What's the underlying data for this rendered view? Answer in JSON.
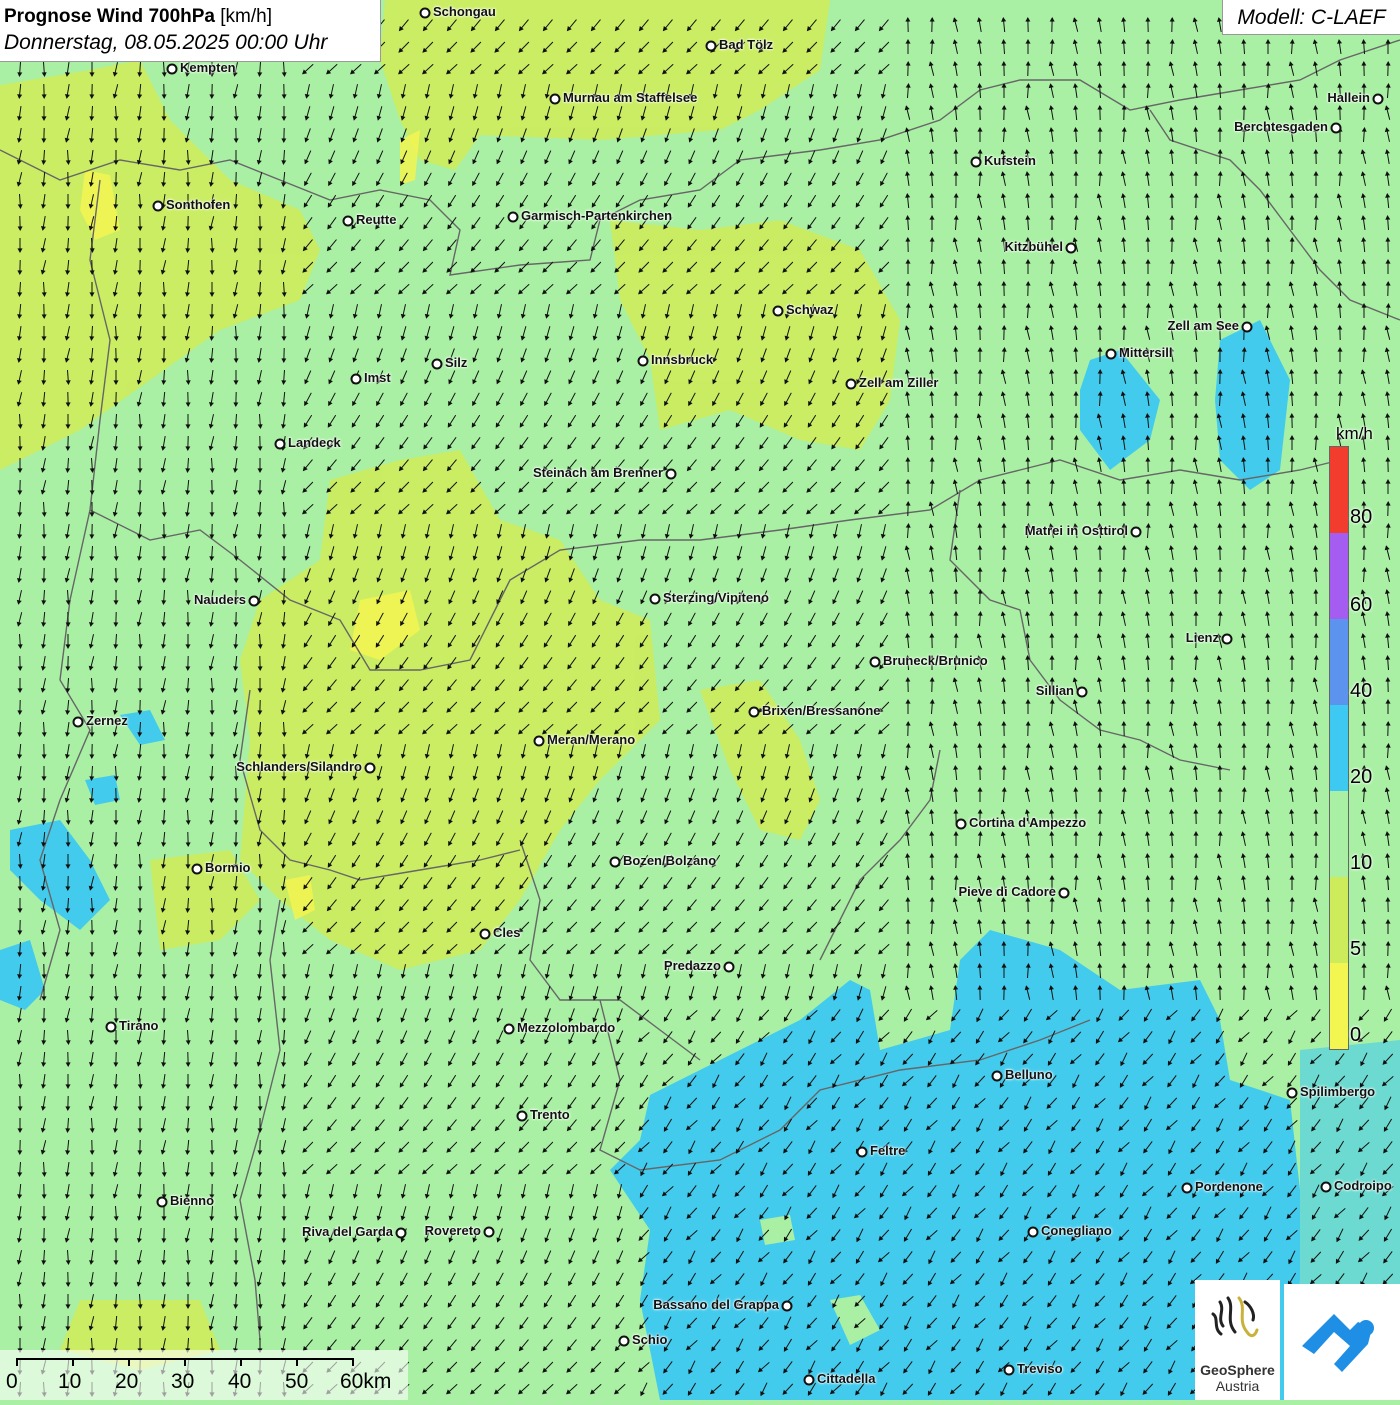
{
  "title": {
    "bold": "Prognose Wind 700hPa",
    "unit": "[km/h]",
    "date": "Donnerstag, 08.05.2025 00:00 Uhr"
  },
  "model": "Modell: C-LAEF",
  "legend": {
    "unit": "km/h",
    "ticks": [
      "80",
      "60",
      "40",
      "20",
      "10",
      "5",
      "0"
    ],
    "colors": [
      "#f23c2e",
      "#a55cf0",
      "#5c93ee",
      "#3ec9f2",
      "#a9f0a4",
      "#cdec5c",
      "#f3f550"
    ]
  },
  "scale": {
    "labels": [
      "0",
      "10",
      "20",
      "30",
      "40",
      "50",
      "60km"
    ]
  },
  "logo": {
    "name": "GeoSphere",
    "sub": "Austria"
  },
  "colors": {
    "calm_green": "#a9f0a4",
    "yellow_green": "#cdec5c",
    "blue": "#3ec9f2",
    "border": "#666666"
  },
  "cities": [
    {
      "name": "Schongau"
    },
    {
      "name": "Kempten"
    },
    {
      "name": "Bad Tölz"
    },
    {
      "name": "Murnau am Staffelsee"
    },
    {
      "name": "Hallein"
    },
    {
      "name": "Berchtesgaden"
    },
    {
      "name": "Kufstein"
    },
    {
      "name": "Sonthofen"
    },
    {
      "name": "Reutte"
    },
    {
      "name": "Garmisch-Partenkirchen"
    },
    {
      "name": "Kitzbühel"
    },
    {
      "name": "Schwaz"
    },
    {
      "name": "Zell am See"
    },
    {
      "name": "Mittersill"
    },
    {
      "name": "Innsbruck"
    },
    {
      "name": "Silz"
    },
    {
      "name": "Imst"
    },
    {
      "name": "Zell am Ziller"
    },
    {
      "name": "Landeck"
    },
    {
      "name": "Steinach am Brenner"
    },
    {
      "name": "Matrei in Osttirol"
    },
    {
      "name": "Nauders"
    },
    {
      "name": "Sterzing/Vipiteno"
    },
    {
      "name": "Lienz"
    },
    {
      "name": "Bruneck/Brunico"
    },
    {
      "name": "Sillian"
    },
    {
      "name": "Zernez"
    },
    {
      "name": "Brixen/Bressanone"
    },
    {
      "name": "Meran/Merano"
    },
    {
      "name": "Schlanders/Silandro"
    },
    {
      "name": "Cortina d'Ampezzo"
    },
    {
      "name": "Bormio"
    },
    {
      "name": "Bozen/Bolzano"
    },
    {
      "name": "Pieve di Cadore"
    },
    {
      "name": "Cles"
    },
    {
      "name": "Predazzo"
    },
    {
      "name": "Tirano"
    },
    {
      "name": "Mezzolombardo"
    },
    {
      "name": "Belluno"
    },
    {
      "name": "Spilimbergo"
    },
    {
      "name": "Trento"
    },
    {
      "name": "Feltre"
    },
    {
      "name": "Pordenone"
    },
    {
      "name": "Codroipo"
    },
    {
      "name": "Bienno"
    },
    {
      "name": "Riva del Garda"
    },
    {
      "name": "Rovereto"
    },
    {
      "name": "Conegliano"
    },
    {
      "name": "Bassano del Grappa"
    },
    {
      "name": "Schio"
    },
    {
      "name": "Treviso"
    },
    {
      "name": "Cittadella"
    }
  ]
}
